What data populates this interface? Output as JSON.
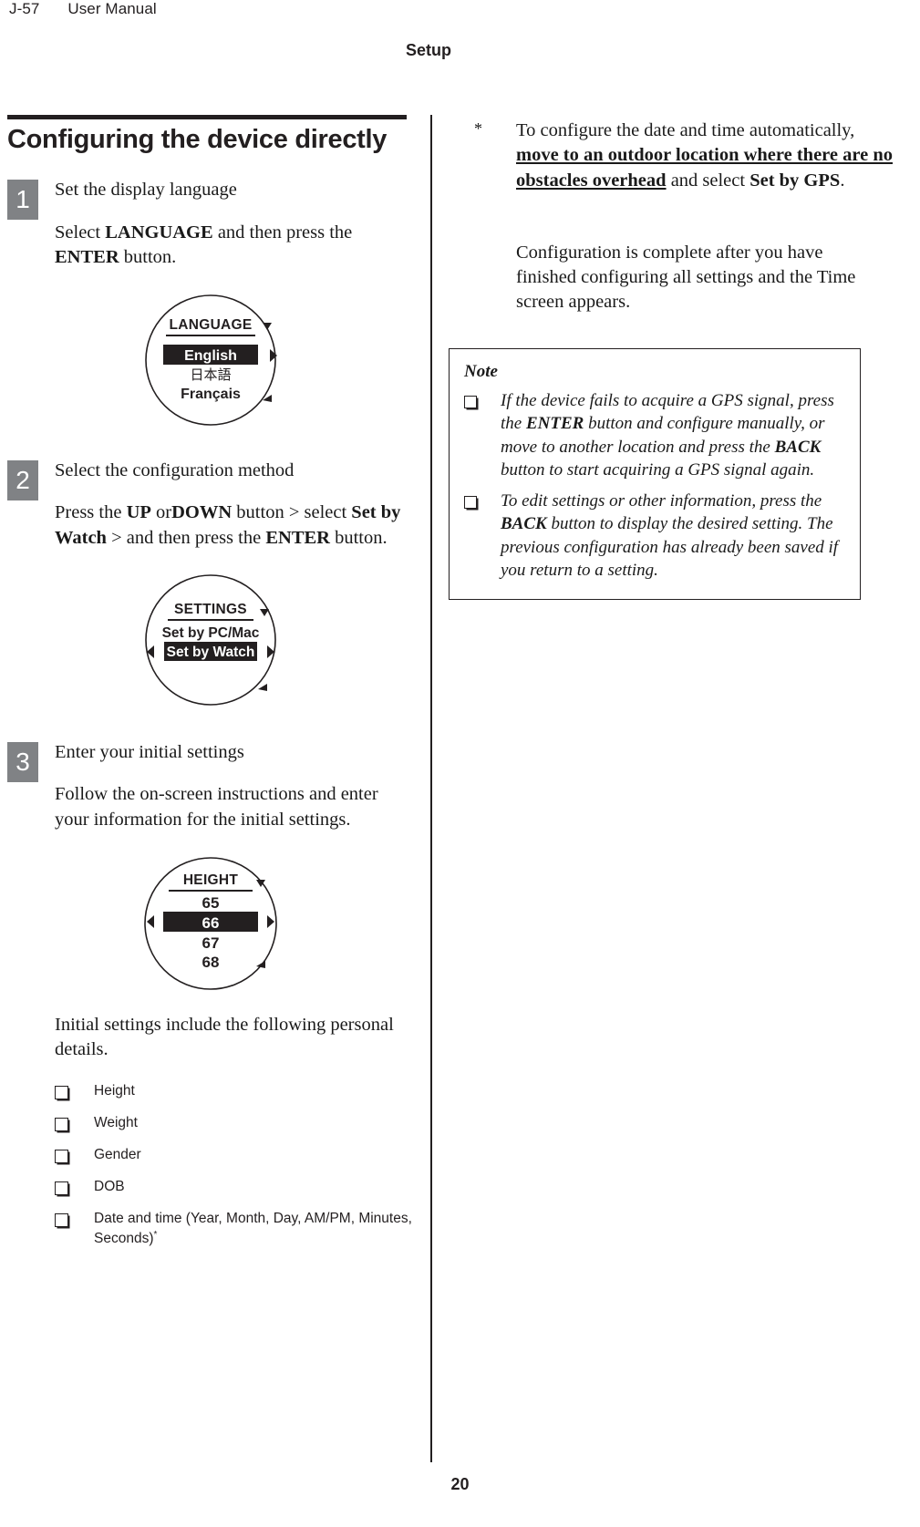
{
  "running_head": {
    "doc_number": "J-57",
    "doc_title": "User Manual"
  },
  "chapter_heading": "Setup",
  "folio": "20",
  "left_column": {
    "section_title": "Configuring the device directly",
    "steps": [
      {
        "number": "1",
        "title": "Set the display language",
        "body_prefix": "Select ",
        "body_bold_1": "LANGUAGE",
        "body_middle": " and then press the ",
        "body_bold_2": "ENTER",
        "body_suffix": " button.",
        "figure": {
          "name": "language-screen",
          "heading": "LANGUAGE",
          "items": [
            "English",
            "日本語",
            "Français"
          ],
          "selected": "English"
        }
      },
      {
        "number": "2",
        "title": "Select the configuration method",
        "body_prefix": "Press the ",
        "body_bold_1": "UP",
        "body_middle_1": " or",
        "body_bold_2": "DOWN",
        "body_middle_2": " button > select ",
        "body_bold_3": "Set by Watch",
        "body_middle_3": " > and then press the ",
        "body_bold_4": "ENTER",
        "body_suffix": " button.",
        "figure": {
          "name": "settings-screen",
          "heading": "SETTINGS",
          "items": [
            "Set by PC/Mac",
            "Set by Watch"
          ],
          "selected": "Set by Watch"
        }
      },
      {
        "number": "3",
        "title": "Enter your initial settings",
        "body_plain": "Follow the on-screen instructions and enter your information for the initial settings.",
        "figure": {
          "name": "height-screen",
          "heading": "HEIGHT",
          "items": [
            "65",
            "66",
            "67",
            "68"
          ],
          "selected": "66"
        }
      }
    ],
    "list_intro": "Initial settings include the following personal details.",
    "settings_list": [
      {
        "label": "Height",
        "footnote_mark": ""
      },
      {
        "label": "Weight",
        "footnote_mark": ""
      },
      {
        "label": "Gender",
        "footnote_mark": ""
      },
      {
        "label": "DOB",
        "footnote_mark": ""
      },
      {
        "label": "Date and time (Year, Month, Day, AM/PM, Minutes, Seconds)",
        "footnote_mark": "*"
      }
    ]
  },
  "right_column": {
    "footnote": {
      "mark": "*",
      "part_1": "To configure the date and time automatically, ",
      "emphasis": "move to an outdoor location where there are no obstacles overhead",
      "part_2": " and select ",
      "bold_2": "Set by GPS",
      "part_3": "."
    },
    "completion_paragraph": "Configuration is complete after you have finished configuring all settings and the Time screen appears.",
    "note_box": {
      "title": "Note",
      "items": [
        {
          "seg_1": "If the device fails to acquire a GPS signal, press the ",
          "bold_1": "ENTER",
          "seg_2": " button and configure manually, or move to another location and press the ",
          "bold_2": "BACK",
          "seg_3": " button to start acquiring a GPS signal again."
        },
        {
          "seg_1": "To edit settings or other information, press the ",
          "bold_1": "BACK",
          "seg_2": " button to display the desired setting. The previous configuration has already been saved if you return to a setting.",
          "bold_2": "",
          "seg_3": ""
        }
      ]
    }
  },
  "colors": {
    "ink": "#231f20",
    "step_badge": "#808285",
    "screen_fill": "#231f20"
  }
}
